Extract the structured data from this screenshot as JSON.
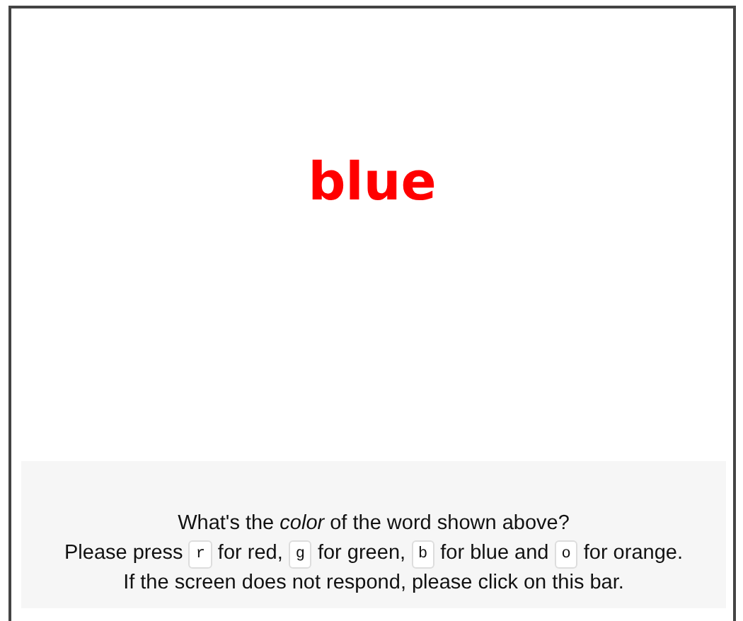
{
  "stimulus": {
    "text": "blue",
    "color": "#ff0000"
  },
  "instructions": {
    "question": "What's the *color* of the word shown above?",
    "keys_line": [
      {
        "kind": "text",
        "text": "Please press"
      },
      {
        "kind": "key",
        "text": "r"
      },
      {
        "kind": "text",
        "text": "for red,"
      },
      {
        "kind": "key",
        "text": "g"
      },
      {
        "kind": "text",
        "text": "for green,"
      },
      {
        "kind": "key",
        "text": "b"
      },
      {
        "kind": "text",
        "text": "for blue and"
      },
      {
        "kind": "key",
        "text": "o"
      },
      {
        "kind": "text",
        "text": "for orange."
      }
    ],
    "help": "If the screen does not respond, please click on this bar."
  }
}
